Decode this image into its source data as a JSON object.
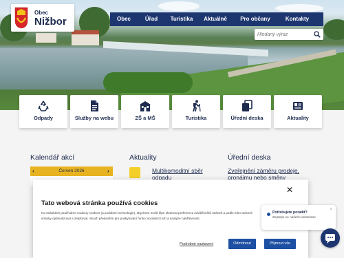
{
  "logo": {
    "obec": "Obec",
    "name": "Nižbor"
  },
  "nav": [
    "Obec",
    "Úřad",
    "Turistika",
    "Aktuálně",
    "Pro občany",
    "Kontakty"
  ],
  "search": {
    "placeholder": "Hledaný výraz"
  },
  "tiles": [
    {
      "label": "Odpady",
      "icon": "recycle-icon"
    },
    {
      "label": "Služby na webu",
      "icon": "document-icon"
    },
    {
      "label": "ZŠ a MŠ",
      "icon": "school-icon"
    },
    {
      "label": "Turistika",
      "icon": "hiker-icon"
    },
    {
      "label": "Úřední deska",
      "icon": "copy-icon"
    },
    {
      "label": "Aktuality",
      "icon": "newspaper-icon"
    }
  ],
  "sections": {
    "calendar": {
      "title": "Kalendář akcí",
      "month": "Červen 2026",
      "prev": "‹",
      "next": "›"
    },
    "news": {
      "title": "Aktuality",
      "item1_line1": "Multikomoditní sběr",
      "item1_line2": "odpadu"
    },
    "board": {
      "title": "Úřední deska",
      "item1_line1": "Zveřejnění záměru prodeje,",
      "item1_line2": "pronájmu nebo směny"
    }
  },
  "cookie": {
    "title": "Tato webová stránka používá cookies",
    "text": "Na stránkách používáme soubory cookies (a podobné technologie), abychom mohli lépe sledovat preference návštěvníků stránek a podle toho webové stránky optimalizovat a zlepšovat. Slouží především pro poskytování funkcí sociálních sítí a analýze návštěvnosti.",
    "close": "✕",
    "settings": "Podrobné nastavení",
    "reject": "Odmítnout",
    "accept": "Přijmout vše"
  },
  "chat": {
    "question": "Potřebujete poradit?",
    "text": "Zeptejte se našeho asistenta!",
    "close": "×"
  },
  "colors": {
    "navy": "#1d3670",
    "accent_yellow": "#e8b321",
    "button_blue": "#1d4fa3"
  }
}
